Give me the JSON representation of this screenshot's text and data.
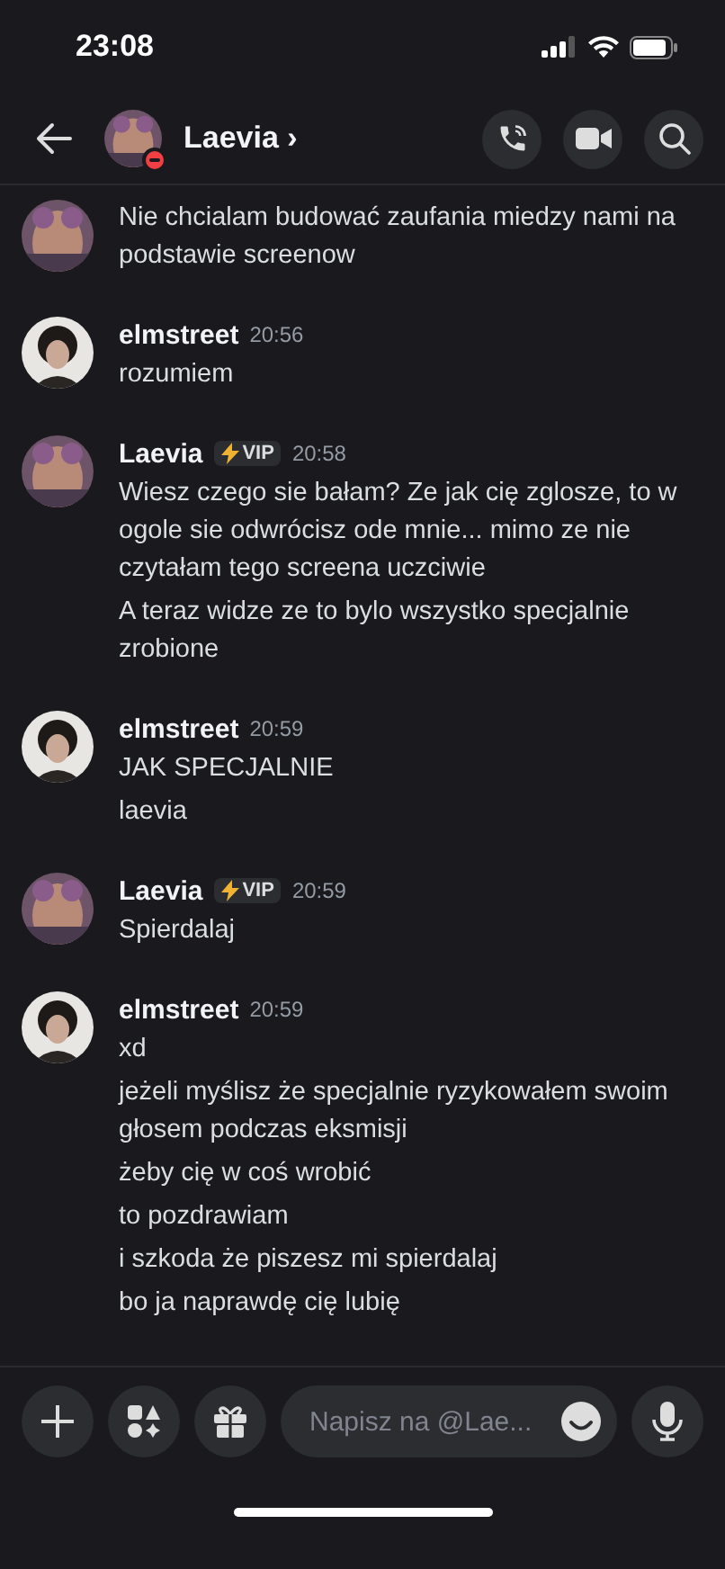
{
  "status_bar": {
    "time": "23:08"
  },
  "header": {
    "name": "Laevia",
    "chevron": "›"
  },
  "groups": [
    {
      "lines": [
        "Nie chcialam budować zaufania miedzy nami na podstawie screenow"
      ]
    },
    {
      "author": "elmstreet",
      "time": "20:56",
      "lines": [
        "rozumiem"
      ]
    },
    {
      "author": "Laevia",
      "badge": "VIP",
      "time": "20:58",
      "lines": [
        "Wiesz czego sie bałam? Ze jak cię zglosze, to w ogole sie odwrócisz ode mnie... mimo ze nie czytałam tego screena uczciwie",
        "A teraz widze ze to bylo wszystko specjalnie zrobione"
      ]
    },
    {
      "author": "elmstreet",
      "time": "20:59",
      "lines": [
        "JAK SPECJALNIE",
        "laevia"
      ]
    },
    {
      "author": "Laevia",
      "badge": "VIP",
      "time": "20:59",
      "lines": [
        "Spierdalaj"
      ]
    },
    {
      "author": "elmstreet",
      "time": "20:59",
      "lines": [
        "xd",
        "jeżeli myślisz że specjalnie ryzykowałem swoim głosem podczas eksmisji",
        "żeby cię w coś wrobić",
        "to pozdrawiam",
        "i szkoda że piszesz mi spierdalaj",
        "bo ja naprawdę cię lubię"
      ]
    }
  ],
  "composer": {
    "placeholder": "Napisz na @Lae..."
  }
}
